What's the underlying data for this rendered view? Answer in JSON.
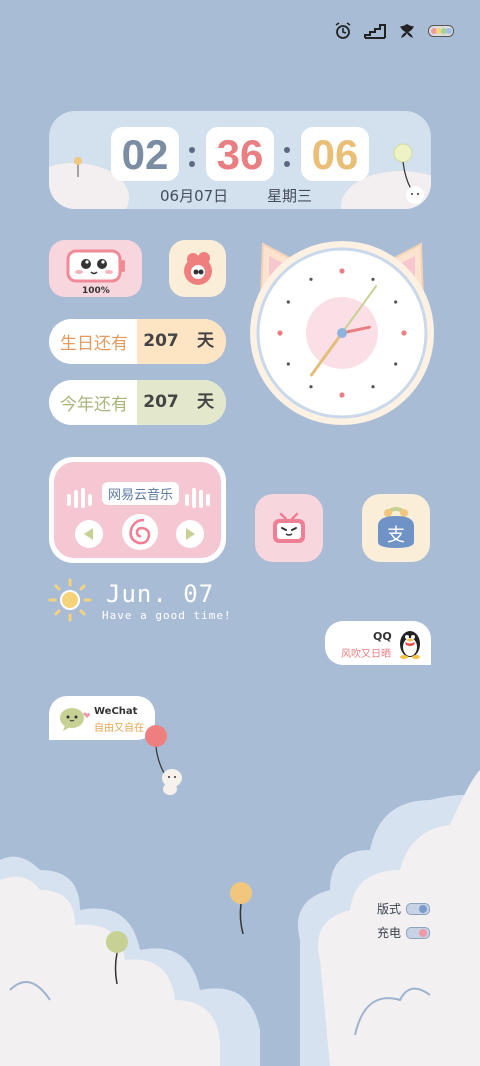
{
  "status_bar": {
    "icons": [
      "alarm-clock-icon",
      "signal-stairs-icon",
      "leaf-icon",
      "battery-icon"
    ]
  },
  "clock_widget": {
    "hours": "02",
    "minutes": "36",
    "seconds": "06",
    "date": "06月07日",
    "weekday": "星期三"
  },
  "battery_widget": {
    "percent": "100%"
  },
  "countdowns": [
    {
      "label": "生日还有",
      "value": "207",
      "unit": "天",
      "label_color": "#e39a5e",
      "bg": "#fde4c3"
    },
    {
      "label": "今年还有",
      "value": "207",
      "unit": "天",
      "label_color": "#a8b57b",
      "bg": "#e3e8cc"
    }
  ],
  "analog_clock": {
    "hour": 2,
    "minute": 36,
    "second": 6
  },
  "music_widget": {
    "title": "网易云音乐",
    "controls": [
      "previous-icon",
      "netease-logo-icon",
      "next-icon"
    ]
  },
  "apps": [
    {
      "name": "bilibili",
      "icon": "bilibili-tv-icon",
      "bg": "#f8d6de"
    },
    {
      "name": "alipay",
      "icon": "alipay-purse-icon",
      "bg": "#fbeed9"
    }
  ],
  "greeting": {
    "date": "Jun. 07",
    "message": "Have a good time!"
  },
  "qq_widget": {
    "title": "QQ",
    "subtitle": "风吹又日晒"
  },
  "wechat_widget": {
    "title": "WeChat",
    "subtitle": "自由又自在"
  },
  "toggles": [
    {
      "label": "版式",
      "state": "blue"
    },
    {
      "label": "充电",
      "state": "pink"
    }
  ]
}
